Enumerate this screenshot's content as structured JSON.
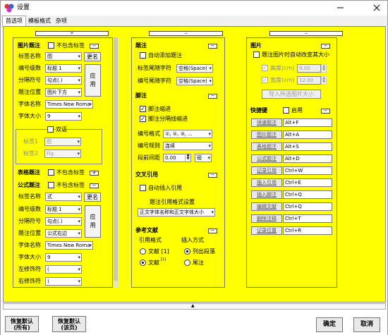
{
  "window": {
    "title": "设置"
  },
  "tabs": [
    "首选项",
    "模板格式",
    "杂项"
  ],
  "collapse_top": "▲",
  "expand_glyph": "+",
  "collapse_glyph": "−",
  "col1": {
    "image_caption": {
      "title": "图片题注",
      "exclude_label": "不包含标签",
      "rows": [
        {
          "label": "标签名称",
          "value": "图"
        },
        {
          "label": "编号级数",
          "value": "标题 1"
        },
        {
          "label": "分隔符号",
          "value": "句点(.)"
        },
        {
          "label": "题注位置",
          "value": "图片下方"
        },
        {
          "label": "字体名称",
          "value": "Times New Roma"
        },
        {
          "label": "字体大小",
          "value": "9"
        }
      ],
      "rename_button": "更名",
      "apply_button": "应用",
      "dual_title": "双语",
      "dual_rows": [
        {
          "label": "标签1",
          "value": "图"
        },
        {
          "label": "标签2",
          "value": "Fig."
        }
      ]
    },
    "table_caption": {
      "title": "表格题注",
      "exclude_label": "不包含标签"
    },
    "formula_caption": {
      "title": "公式题注",
      "exclude_label": "不包含标签",
      "rows": [
        {
          "label": "标签名称",
          "value": "式"
        },
        {
          "label": "编号级数",
          "value": "标题 1"
        },
        {
          "label": "分隔符号",
          "value": "句点(.)"
        },
        {
          "label": "题注位置",
          "value": "公式右边"
        },
        {
          "label": "字体名称",
          "value": "Times New Roma"
        },
        {
          "label": "字体大小",
          "value": "9"
        },
        {
          "label": "左修饰符",
          "value": "("
        },
        {
          "label": "右修饰符",
          "value": ")"
        }
      ],
      "rename_button": "更名",
      "apply_button": "应用"
    }
  },
  "col2": {
    "caption": {
      "title": "题注",
      "auto_add": "自动添加题注",
      "rows": [
        {
          "label": "标签尾随字符",
          "value": "空格(Space)"
        },
        {
          "label": "编号尾随字符",
          "value": "空格(Space)"
        }
      ]
    },
    "footnote": {
      "title": "脚注",
      "indent": "脚注缩进",
      "sep_indent": "脚注分隔线缩进",
      "format_label": "编号格式",
      "format_value": "①, ②, ③, ...",
      "rule_label": "编号规则",
      "rule_value": "连续",
      "spacing_label": "段前间距",
      "spacing_value": "0.00",
      "spacing_unit": "磅"
    },
    "crossref": {
      "title": "交叉引用",
      "auto_insert": "自动插入引用",
      "setting_label": "题注引用格式设置",
      "setting_value": "正文字体名称和正文字体大小"
    },
    "references": {
      "title": "参考文献",
      "cite_format": "引用格式",
      "insert_method": "插入方式",
      "opt_text1": "文献 [1]",
      "opt_text2": "文献",
      "opt_text2_sup": "[1]",
      "opt_list": "列出段落",
      "opt_endnote": "尾注"
    }
  },
  "col3": {
    "image": {
      "title": "图片",
      "auto_size": "题注图片时自动改变其大小",
      "height_label": "高度(cm)",
      "height_value": "9.00",
      "width_label": "宽度(cm)",
      "width_value": "12.00",
      "import_button": "导入所选图片大小"
    },
    "shortcuts": {
      "title": "快捷键",
      "enable_label": "启用",
      "items": [
        {
          "label": "快速题注",
          "key": "Alt+F"
        },
        {
          "label": "图片题注",
          "key": "Alt+A"
        },
        {
          "label": "表格题注",
          "key": "Alt+S"
        },
        {
          "label": "公式题注",
          "key": "Alt+D"
        },
        {
          "label": "记录引用",
          "key": "Ctrl+W"
        },
        {
          "label": "插入引用",
          "key": "Ctrl+E"
        },
        {
          "label": "插入脚注",
          "key": "Ctrl+Q"
        },
        {
          "label": "编辑文献",
          "key": "Ctrl+Q"
        },
        {
          "label": "删除注释",
          "key": "Ctrl+T"
        },
        {
          "label": "记录位置",
          "key": "Ctrl+R"
        }
      ]
    }
  },
  "footer": {
    "restore_all": [
      "恢复默认",
      "(所有)"
    ],
    "restore_page": [
      "恢复默认",
      "(该页)"
    ],
    "ok": "确定",
    "cancel": "取消"
  }
}
